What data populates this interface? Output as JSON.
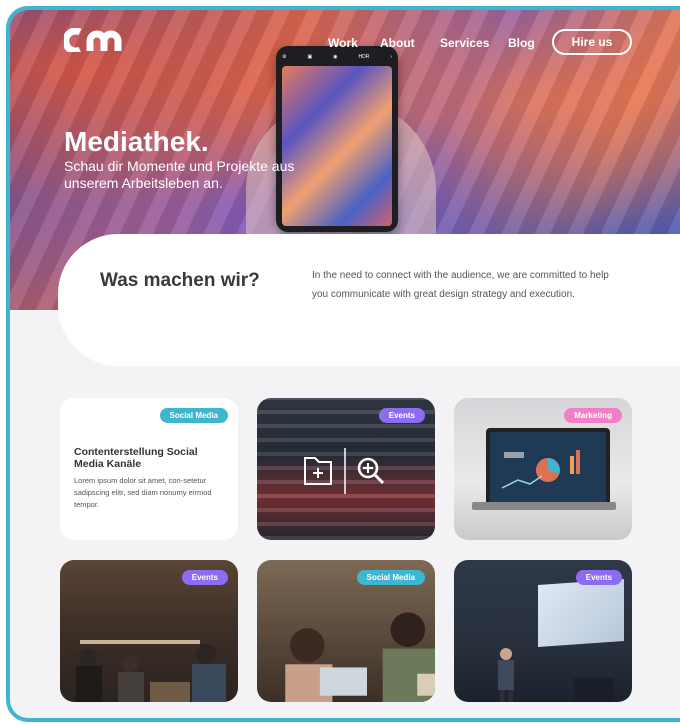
{
  "nav": {
    "logo": "cm",
    "links": [
      "Work",
      "About",
      "Services",
      "Blog"
    ],
    "cta": "Hire us"
  },
  "hero": {
    "title": "Mediathek.",
    "subtitle": "Schau dir Momente und Projekte aus unserem Arbeitsleben an."
  },
  "intro": {
    "title": "Was machen wir?",
    "text": "In the need to connect with the audience, we are committed to help you communicate with great design strategy and execution."
  },
  "cards": [
    {
      "tag": "Social Media",
      "title": "Contenterstellung Social Media Kanäle",
      "body": "Lorem ipsum dolor sit amet, con-setetur sadipscing elitr, sed diam nonumy eirmod tempor."
    },
    {
      "tag": "Events",
      "icons": [
        "folder-add-icon",
        "zoom-in-icon"
      ]
    },
    {
      "tag": "Marketing"
    },
    {
      "tag": "Events"
    },
    {
      "tag": "Social Media"
    },
    {
      "tag": "Events"
    }
  ],
  "colors": {
    "frame": "#3fb6d0",
    "social": "#3fb6d0",
    "events": "#8c6cf0",
    "marketing": "#f07fc7"
  }
}
